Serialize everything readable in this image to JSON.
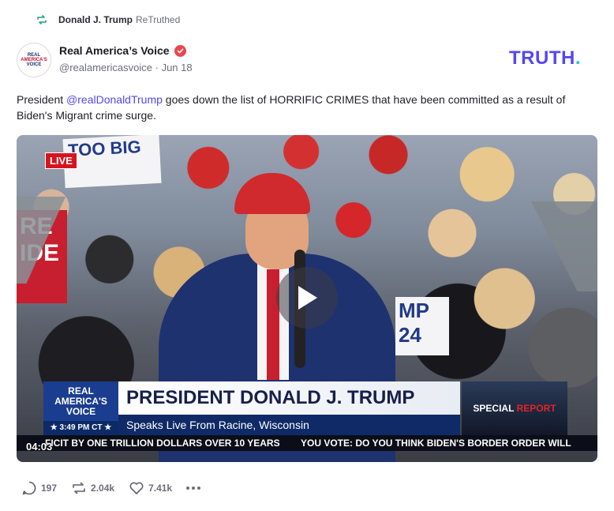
{
  "retruth": {
    "user": "Donald J. Trump",
    "label": "ReTruthed"
  },
  "author": {
    "name": "Real America’s Voice",
    "handle": "@realamericasvoice",
    "separator": "·",
    "date": "Jun 18",
    "avatar_text": [
      "REAL",
      "AMERICA'S",
      "VOICE"
    ]
  },
  "brand": {
    "logo_text": "TRUTH",
    "logo_dot": ".",
    "color": "#5448ee",
    "accent": "#21c9c1"
  },
  "post": {
    "prefix": "President ",
    "mention": "@realDonaldTrump",
    "suffix": " goes down the list of HORRIFIC CRIMES that have been committed as a result of Biden's Migrant crime surge."
  },
  "video": {
    "live_badge": "LIVE",
    "duration": "04:03",
    "lower_third": {
      "logo_line1": "REAL",
      "logo_line2": "AMERICA'S",
      "logo_line3": "VOICE",
      "time": "★ 3:49 PM CT ★",
      "title": "PRESIDENT DONALD J. TRUMP",
      "subtitle": "Speaks Live From Racine, Wisconsin",
      "special_a": "SPECIAL",
      "special_b": "REPORT"
    },
    "ticker_left": "FICIT BY ONE TRILLION DOLLARS OVER 10 YEARS",
    "ticker_right": "YOU VOTE: DO YOU THINK BIDEN'S BORDER ORDER WILL",
    "sign_1": "TOO BIG",
    "sign_2": "MP 24",
    "sign_3": "RE IDE"
  },
  "actions": {
    "replies": "197",
    "retruths": "2.04k",
    "likes": "7.41k"
  }
}
